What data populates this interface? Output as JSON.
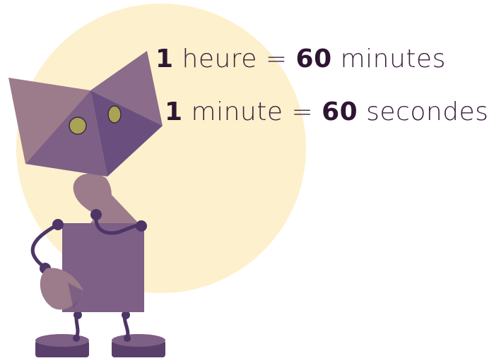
{
  "equations": {
    "hour": {
      "lhs_number": "1",
      "lhs_unit": "heure",
      "equals": "=",
      "rhs_number": "60",
      "rhs_unit": "minutes"
    },
    "minute": {
      "lhs_number": "1",
      "lhs_unit": "minute",
      "equals": "=",
      "rhs_number": "60",
      "rhs_unit": "secondes"
    }
  },
  "colors": {
    "sun": "#fdf0cc",
    "body_purple": "#7e5f86",
    "head_light": "#9c7c8a",
    "head_dark": "#6a4f7e",
    "joint": "#4d3566",
    "eye": "#a9a355",
    "text": "#2e1532"
  }
}
